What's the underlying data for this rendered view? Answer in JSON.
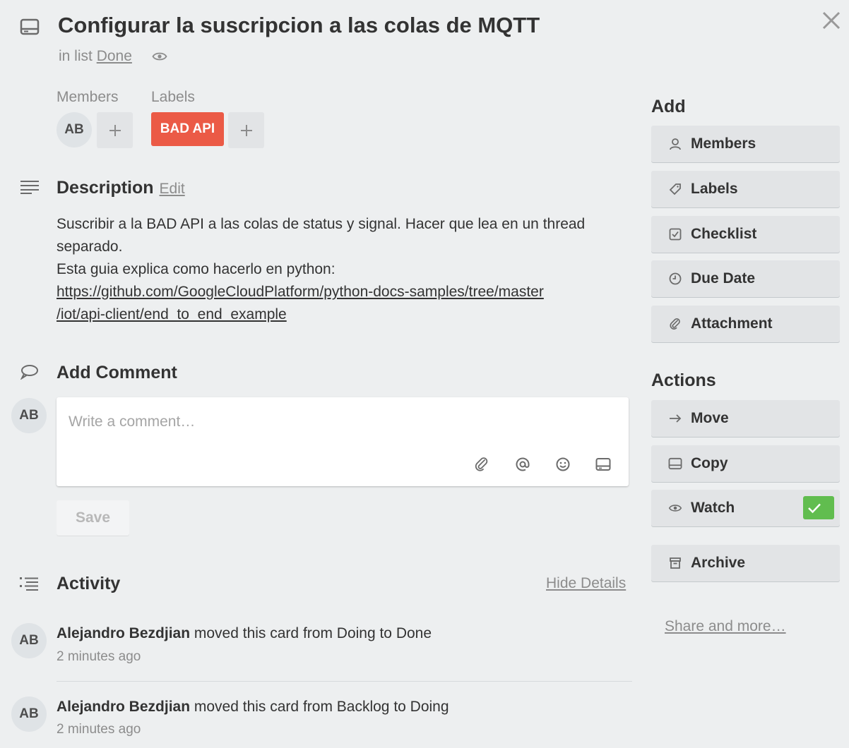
{
  "card": {
    "title": "Configurar la suscripcion a las colas de MQTT",
    "list_prefix": "in list",
    "list_name": "Done"
  },
  "members": {
    "label": "Members",
    "avatar_initials": "AB",
    "add_symbol": "+"
  },
  "labels": {
    "label": "Labels",
    "badge_text": "BAD API",
    "badge_color": "#eb5a46",
    "add_symbol": "+"
  },
  "description": {
    "heading": "Description",
    "edit_label": "Edit",
    "line1": "Suscribir a la BAD API a las colas de status y signal. Hacer que lea en un thread",
    "line2": "separado.",
    "line3": "Esta guia explica como hacerlo en python:",
    "link_line1": "https://github.com/GoogleCloudPlatform/python-docs-samples/tree/master",
    "link_line2": "/iot/api-client/end_to_end_example"
  },
  "comment": {
    "heading": "Add Comment",
    "avatar_initials": "AB",
    "placeholder": "Write a comment…",
    "save_label": "Save"
  },
  "activity": {
    "heading": "Activity",
    "hide_details_label": "Hide Details",
    "items": [
      {
        "avatar_initials": "AB",
        "user": "Alejandro Bezdjian",
        "action": "moved this card from Doing to Done",
        "time": "2 minutes ago"
      },
      {
        "avatar_initials": "AB",
        "user": "Alejandro Bezdjian",
        "action": "moved this card from Backlog to Doing",
        "time": "2 minutes ago"
      }
    ]
  },
  "sidebar": {
    "add_heading": "Add",
    "add_buttons": [
      {
        "label": "Members",
        "icon": "person-icon"
      },
      {
        "label": "Labels",
        "icon": "tag-icon"
      },
      {
        "label": "Checklist",
        "icon": "checkbox-icon"
      },
      {
        "label": "Due Date",
        "icon": "clock-icon"
      },
      {
        "label": "Attachment",
        "icon": "paperclip-icon"
      }
    ],
    "actions_heading": "Actions",
    "action_buttons": [
      {
        "label": "Move",
        "icon": "arrow-right-icon"
      },
      {
        "label": "Copy",
        "icon": "card-icon"
      },
      {
        "label": "Watch",
        "icon": "eye-icon",
        "active": true
      },
      {
        "label": "Archive",
        "icon": "archive-icon"
      }
    ],
    "share_label": "Share and more…"
  },
  "colors": {
    "background": "#edeff0",
    "label_red": "#eb5a46",
    "watch_green": "#61bd4f"
  }
}
